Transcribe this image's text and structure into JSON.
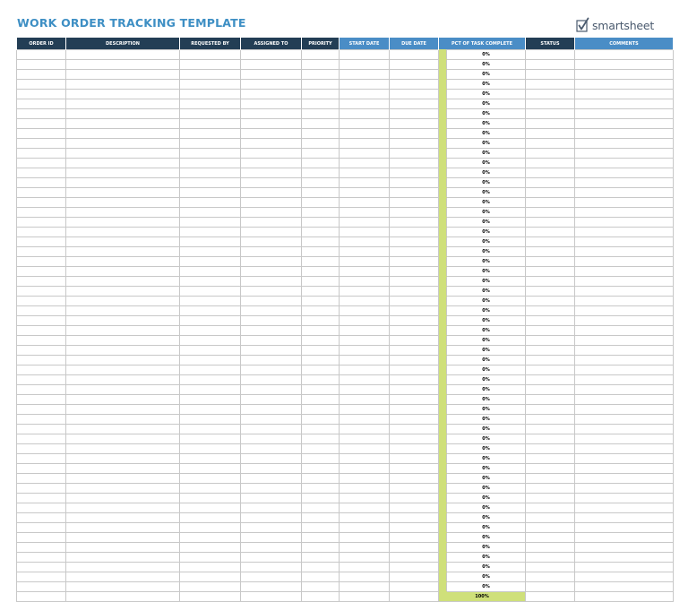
{
  "title": "WORK ORDER TRACKING TEMPLATE",
  "logo": {
    "text": "smartsheet",
    "icon": "checkbox-check-icon"
  },
  "colors": {
    "header_dark": "#233E55",
    "header_light": "#4A8DC6",
    "progress_fill": "#CFE07A",
    "title": "#3E8FC4"
  },
  "columns": [
    {
      "label": "ORDER ID"
    },
    {
      "label": "DESCRIPTION"
    },
    {
      "label": "REQUESTED BY"
    },
    {
      "label": "ASSIGNED TO"
    },
    {
      "label": "PRIORITY"
    },
    {
      "label": "START DATE"
    },
    {
      "label": "DUE DATE"
    },
    {
      "label": "PCT OF TASK COMPLETE"
    },
    {
      "label": "STATUS"
    },
    {
      "label": "COMMENTS"
    }
  ],
  "rows": [
    {
      "pct": "0%"
    },
    {
      "pct": "0%"
    },
    {
      "pct": "0%"
    },
    {
      "pct": "0%"
    },
    {
      "pct": "0%"
    },
    {
      "pct": "0%"
    },
    {
      "pct": "0%"
    },
    {
      "pct": "0%"
    },
    {
      "pct": "0%"
    },
    {
      "pct": "0%"
    },
    {
      "pct": "0%"
    },
    {
      "pct": "0%"
    },
    {
      "pct": "0%"
    },
    {
      "pct": "0%"
    },
    {
      "pct": "0%"
    },
    {
      "pct": "0%"
    },
    {
      "pct": "0%"
    },
    {
      "pct": "0%"
    },
    {
      "pct": "0%"
    },
    {
      "pct": "0%"
    },
    {
      "pct": "0%"
    },
    {
      "pct": "0%"
    },
    {
      "pct": "0%"
    },
    {
      "pct": "0%"
    },
    {
      "pct": "0%"
    },
    {
      "pct": "0%"
    },
    {
      "pct": "0%"
    },
    {
      "pct": "0%"
    },
    {
      "pct": "0%"
    },
    {
      "pct": "0%"
    },
    {
      "pct": "0%"
    },
    {
      "pct": "0%"
    },
    {
      "pct": "0%"
    },
    {
      "pct": "0%"
    },
    {
      "pct": "0%"
    },
    {
      "pct": "0%"
    },
    {
      "pct": "0%"
    },
    {
      "pct": "0%"
    },
    {
      "pct": "0%"
    },
    {
      "pct": "0%"
    },
    {
      "pct": "0%"
    },
    {
      "pct": "0%"
    },
    {
      "pct": "0%"
    },
    {
      "pct": "0%"
    },
    {
      "pct": "0%"
    },
    {
      "pct": "0%"
    },
    {
      "pct": "0%"
    },
    {
      "pct": "0%"
    },
    {
      "pct": "0%"
    },
    {
      "pct": "0%"
    },
    {
      "pct": "0%"
    },
    {
      "pct": "0%"
    },
    {
      "pct": "0%"
    },
    {
      "pct": "0%"
    },
    {
      "pct": "0%"
    }
  ],
  "total": {
    "pct": "100%"
  }
}
